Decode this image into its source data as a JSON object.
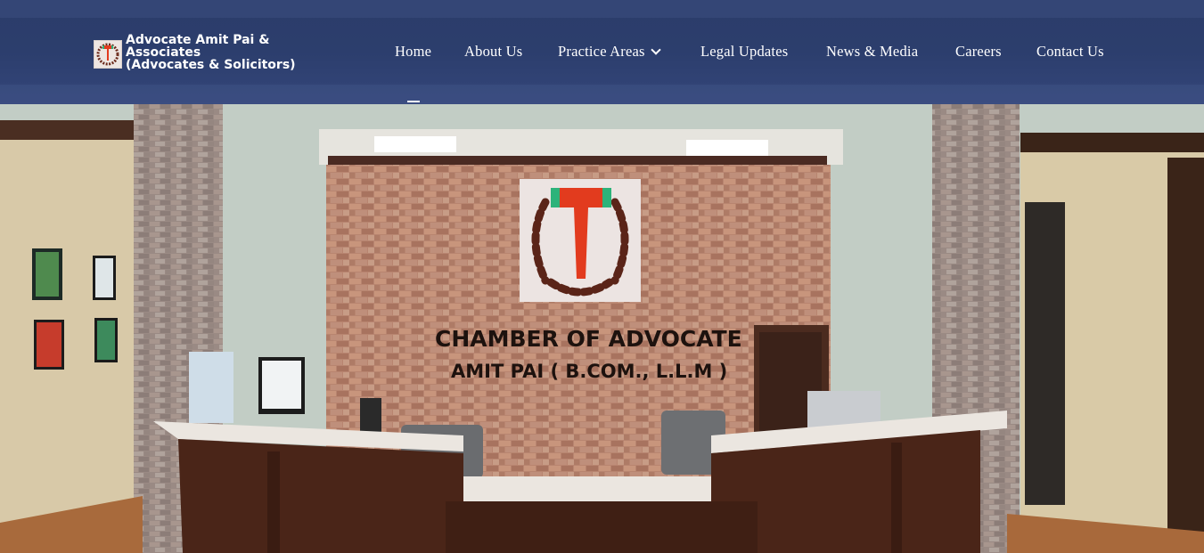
{
  "header": {
    "logo_line1": "Advocate Amit Pai &",
    "logo_line2": "Associates",
    "logo_line3": "(Advocates & Solicitors)"
  },
  "nav": {
    "items": [
      {
        "label": "Home"
      },
      {
        "label": "About Us"
      },
      {
        "label": "Practice Areas"
      },
      {
        "label": "Legal Updates"
      },
      {
        "label": "News & Media"
      },
      {
        "label": "Careers"
      },
      {
        "label": "Contact Us"
      }
    ]
  },
  "hero": {
    "sign_line1": "CHAMBER OF ADVOCATE",
    "sign_line2": "AMIT PAI ( B.COM., L.L.M )"
  },
  "colors": {
    "header_bg": "#2c3e6d",
    "nav_text": "#ffffff",
    "gavel_red": "#e23b1e",
    "gavel_green": "#2db37a",
    "laurel_brown": "#5a2418"
  }
}
